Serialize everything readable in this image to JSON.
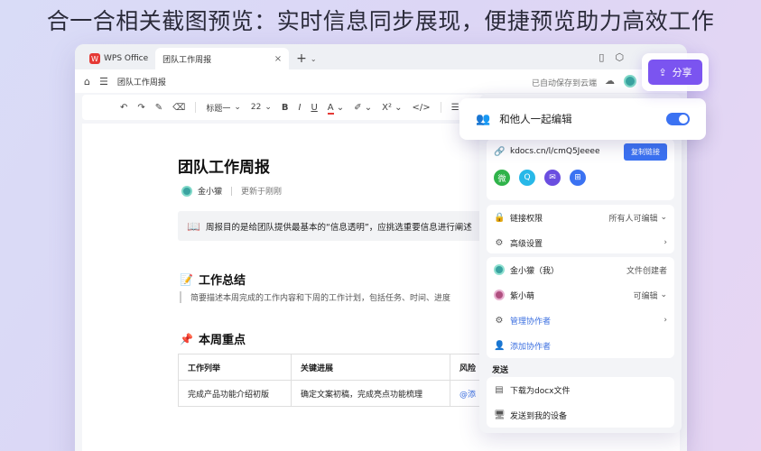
{
  "headline": "合一合相关截图预览：实时信息同步展现，便捷预览助力高效工作",
  "tabs": [
    {
      "label": "WPS Office",
      "logo": "W"
    },
    {
      "label": "团队工作周报",
      "logo": "▤",
      "close": "×"
    }
  ],
  "tab_add": "+",
  "tab_chevron": "⌄",
  "header": {
    "breadcrumb": "团队工作周报",
    "autosave": "已自动保存到云端"
  },
  "toolbar": {
    "style_label": "标题一",
    "size_label": "22",
    "bold": "B",
    "italic": "I",
    "underline": "U",
    "font_color": "A",
    "superscript": "X²",
    "code": "</>"
  },
  "doc": {
    "title": "团队工作周报",
    "author": "金小獴",
    "updated": "更新于刚刚",
    "callout": "周报目的是给团队提供最基本的“信息透明”，应挑选重要信息进行阐述",
    "section1": {
      "emoji": "📝",
      "title": "工作总结"
    },
    "section1_text": "简要描述本周完成的工作内容和下周的工作计划，包括任务、时间、进度",
    "section2": {
      "emoji": "📌",
      "title": "本周重点"
    },
    "table": {
      "headers": [
        "工作列举",
        "关键进展",
        "风险"
      ],
      "rows": [
        [
          "完成产品功能介绍初版",
          "确定文案初稿，完成亮点功能梳理",
          "@添"
        ]
      ]
    }
  },
  "share": {
    "button_label": "分享",
    "collab_label": "和他人一起编辑",
    "link": "kdocs.cn/l/cmQ5Jeeee",
    "copy_label": "复制链接",
    "social": [
      "微",
      "Q",
      "✉",
      "⊞"
    ],
    "permission_label": "链接权限",
    "permission_value": "所有人可编辑",
    "advanced_label": "高级设置",
    "members": [
      {
        "name": "金小獴（我）",
        "role": "文件创建者"
      },
      {
        "name": "紫小萌",
        "role": "可编辑"
      }
    ],
    "manage_label": "管理协作者",
    "add_label": "添加协作者",
    "send_section": "发送",
    "download_label": "下载为docx文件",
    "send_device_label": "发送到我的设备"
  },
  "colors": {
    "accent": "#7b54f0",
    "primary_blue": "#3b72f2",
    "wps_red": "#e53935"
  }
}
